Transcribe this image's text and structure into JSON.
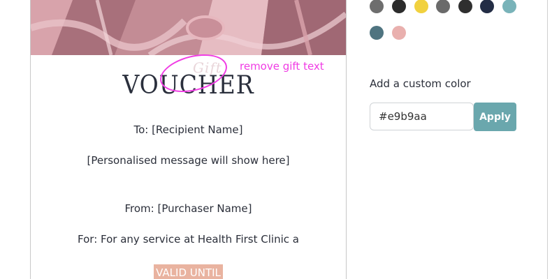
{
  "voucher": {
    "title": "VOUCHER",
    "gift_text": "Gift",
    "to_line": "To: [Recipient Name]",
    "message_line": "[Personalised message will show here]",
    "from_line": "From: [Purchaser Name]",
    "for_line": "For: For any service at Health First Clinic a",
    "valid_label": "VALID UNTIL"
  },
  "annotation": {
    "text": "remove gift text",
    "color": "#f03ce4"
  },
  "palette": {
    "colors": [
      "#6e6e6e",
      "#2c2c2c",
      "#f1d13f",
      "#6a6a6a",
      "#2f2f2f",
      "#232d45",
      "#79b3b9",
      "#4f7480",
      "#e9b0ae"
    ]
  },
  "custom_color": {
    "label": "Add a custom color",
    "value": "#e9b9aa",
    "apply_label": "Apply"
  }
}
